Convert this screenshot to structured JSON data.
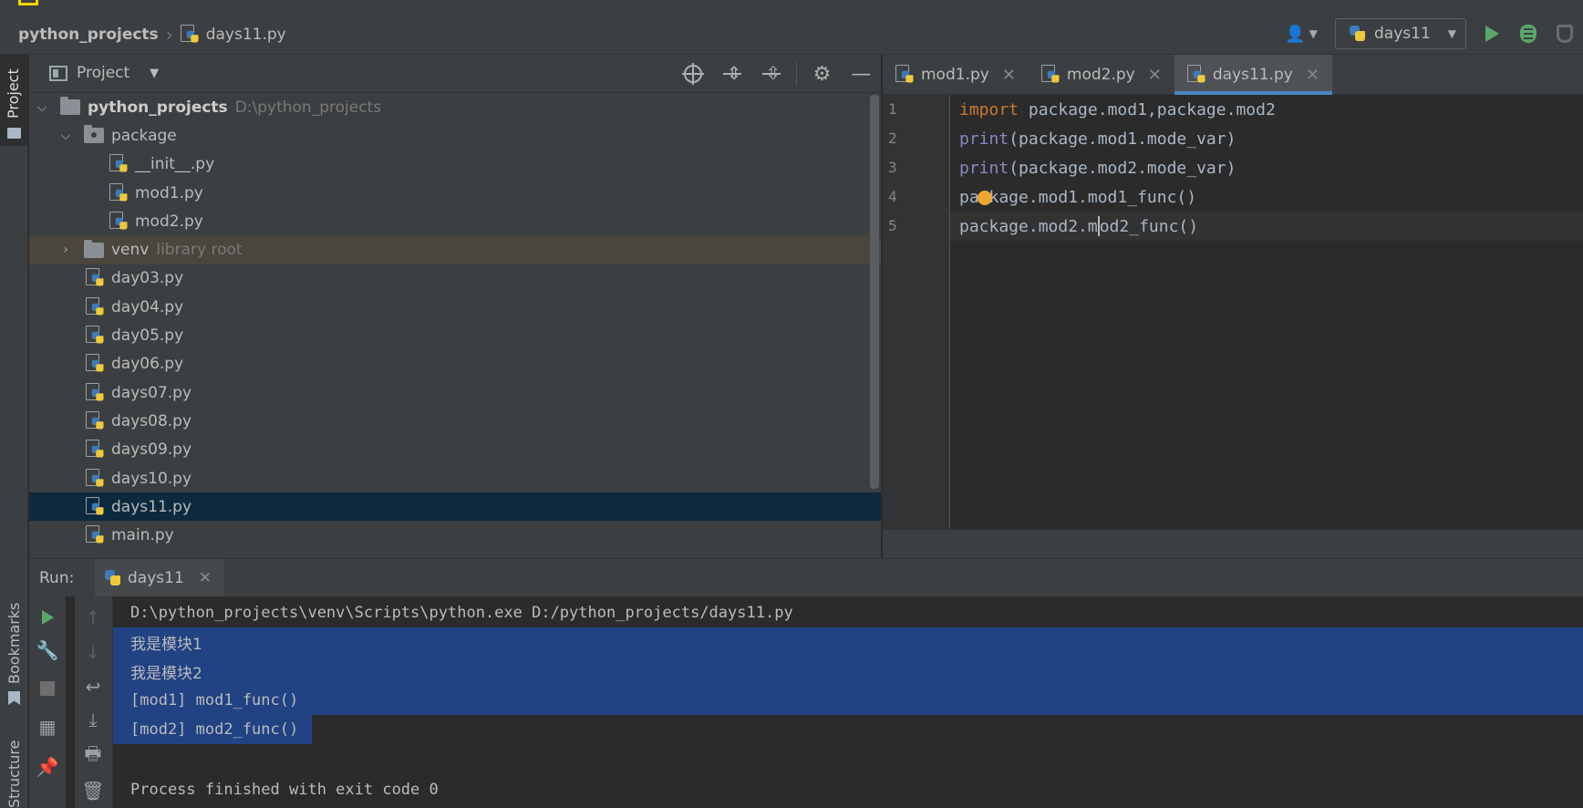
{
  "breadcrumb": {
    "root": "python_projects",
    "file": "days11.py"
  },
  "toolbar": {
    "run_config": "days11"
  },
  "project_panel": {
    "title": "Project",
    "tree": [
      {
        "label": "python_projects",
        "hint": "D:\\python_projects",
        "kind": "root-folder",
        "depth": 0,
        "expanded": true
      },
      {
        "label": "package",
        "kind": "package-folder",
        "depth": 1,
        "expanded": true
      },
      {
        "label": "__init__.py",
        "kind": "file",
        "depth": 2
      },
      {
        "label": "mod1.py",
        "kind": "file",
        "depth": 2
      },
      {
        "label": "mod2.py",
        "kind": "file",
        "depth": 2
      },
      {
        "label": "venv",
        "hint": "library root",
        "kind": "folder",
        "depth": 1,
        "expanded": false,
        "library": true
      },
      {
        "label": "day03.py",
        "kind": "file",
        "depth": 1
      },
      {
        "label": "day04.py",
        "kind": "file",
        "depth": 1
      },
      {
        "label": "day05.py",
        "kind": "file",
        "depth": 1
      },
      {
        "label": "day06.py",
        "kind": "file",
        "depth": 1
      },
      {
        "label": "days07.py",
        "kind": "file",
        "depth": 1
      },
      {
        "label": "days08.py",
        "kind": "file",
        "depth": 1
      },
      {
        "label": "days09.py",
        "kind": "file",
        "depth": 1
      },
      {
        "label": "days10.py",
        "kind": "file",
        "depth": 1
      },
      {
        "label": "days11.py",
        "kind": "file",
        "depth": 1,
        "selected": true
      },
      {
        "label": "main.py",
        "kind": "file",
        "depth": 1
      }
    ]
  },
  "side_tabs": {
    "project": "Project",
    "bookmarks": "Bookmarks",
    "structure": "Structure"
  },
  "editor": {
    "tabs": [
      {
        "label": "mod1.py",
        "active": false
      },
      {
        "label": "mod2.py",
        "active": false
      },
      {
        "label": "days11.py",
        "active": true
      }
    ],
    "line_numbers": [
      "1",
      "2",
      "3",
      "4",
      "5"
    ],
    "lines": {
      "l1": {
        "kw": "import",
        "rest": " package.mod1,package.mod2"
      },
      "l2": {
        "fn": "print",
        "rest": "(package.mod1.mode_var)"
      },
      "l3": {
        "fn": "print",
        "rest": "(package.mod2.mode_var)"
      },
      "l4": {
        "text": "package.mod1.mod1_func()"
      },
      "l5": {
        "before": "package.mod2.m",
        "after": "od2_func()"
      }
    }
  },
  "run_panel": {
    "label": "Run:",
    "tab": "days11",
    "output": {
      "cmd": "D:\\python_projects\\venv\\Scripts\\python.exe D:/python_projects/days11.py",
      "o1": "我是模块1",
      "o2": "我是模块2",
      "o3": "[mod1] mod1_func()",
      "o4": "[mod2] mod2_func()",
      "exit": "Process finished with exit code 0"
    }
  },
  "colors": {
    "accent": "#4a88c7",
    "selection": "#214283",
    "run_green": "#59a869",
    "keyword": "#cc7832"
  }
}
